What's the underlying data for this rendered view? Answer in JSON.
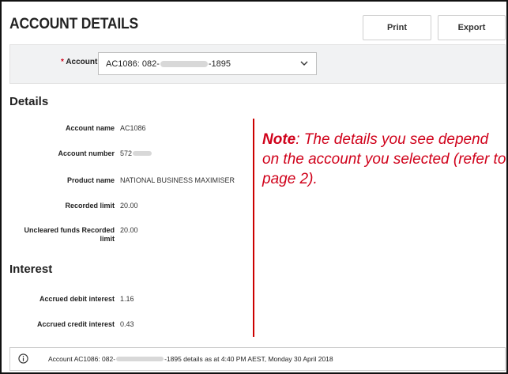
{
  "header": {
    "title": "ACCOUNT DETAILS",
    "print_label": "Print",
    "export_label": "Export"
  },
  "account_selector": {
    "required_mark": "*",
    "label": "Account",
    "value_prefix": "AC1086: 082-",
    "value_suffix": "-1895"
  },
  "details": {
    "heading": "Details",
    "rows": [
      {
        "label": "Account name",
        "value": "AC1086",
        "masked": false
      },
      {
        "label": "Account number",
        "value": "572",
        "masked": true
      },
      {
        "label": "Product name",
        "value": "NATIONAL BUSINESS MAXIMISER",
        "masked": false
      },
      {
        "label": "Recorded limit",
        "value": "20.00",
        "masked": false
      },
      {
        "label": "Uncleared funds Recorded limit",
        "value": "20.00",
        "masked": false
      }
    ]
  },
  "interest": {
    "heading": "Interest",
    "rows": [
      {
        "label": "Accrued debit interest",
        "value": "1.16"
      },
      {
        "label": "Accrued credit interest",
        "value": "0.43"
      }
    ]
  },
  "note": {
    "lead": "Note",
    "text": ": The details you see depend on the account you selected (refer to page 2)."
  },
  "footer": {
    "prefix": "Account AC1086: 082-",
    "suffix": "-1895 details as at 4:40 PM AEST, Monday 30 April 2018"
  },
  "colors": {
    "accent": "#d0021b",
    "divider": "#cc0000",
    "bar_bg": "#f1f2f3"
  },
  "icons": {
    "select": "chevron-down-icon",
    "footer": "info-icon"
  }
}
